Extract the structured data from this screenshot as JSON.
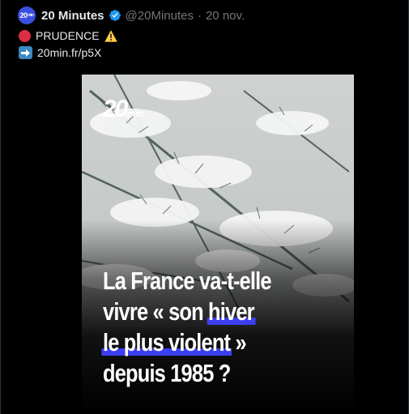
{
  "tweet": {
    "author_name": "20 Minutes",
    "handle": "@20Minutes",
    "separator": "·",
    "date": "20 nov.",
    "avatar_text": "20",
    "avatar_subtext": "min",
    "line1_text": "PRUDENCE",
    "line2_link": "20min.fr/p5X",
    "icons": [
      "red-circle-icon",
      "warning-icon",
      "right-arrow-icon",
      "verified-badge-icon"
    ]
  },
  "media": {
    "logo_text": "20",
    "logo_subtext": "min",
    "headline": {
      "row1": "La France va-t-elle",
      "row2_plain": "vivre « son ",
      "row2_highlight": "hiver",
      "row3_highlight": "le plus violent",
      "row3_plain": " »",
      "row4": "depuis 1985 ?"
    },
    "highlight_color": "#3c3ff0"
  },
  "colors": {
    "background": "#000000",
    "text": "#e7e9ea",
    "secondary": "#71767b",
    "brand": "#3a4fe0",
    "verified": "#1d9bf0"
  }
}
